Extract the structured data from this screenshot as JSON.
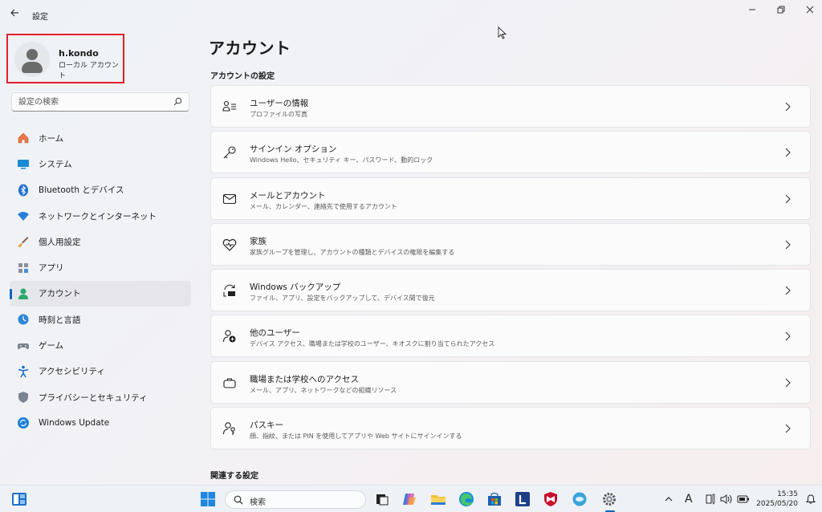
{
  "window": {
    "title": "設定",
    "back_icon": "back-arrow-icon",
    "controls": [
      "minimize",
      "maximize",
      "close"
    ]
  },
  "user": {
    "name": "h.kondo",
    "account_type": "ローカル アカウント"
  },
  "search": {
    "placeholder": "設定の検索"
  },
  "sidebar": {
    "items": [
      {
        "label": "ホーム",
        "icon": "home-icon",
        "active": false
      },
      {
        "label": "システム",
        "icon": "system-icon",
        "active": false
      },
      {
        "label": "Bluetooth とデバイス",
        "icon": "bluetooth-icon",
        "active": false
      },
      {
        "label": "ネットワークとインターネット",
        "icon": "network-icon",
        "active": false
      },
      {
        "label": "個人用設定",
        "icon": "personalization-brush-icon",
        "active": false
      },
      {
        "label": "アプリ",
        "icon": "apps-icon",
        "active": false
      },
      {
        "label": "アカウント",
        "icon": "account-icon",
        "active": true
      },
      {
        "label": "時刻と言語",
        "icon": "time-language-icon",
        "active": false
      },
      {
        "label": "ゲーム",
        "icon": "gaming-icon",
        "active": false
      },
      {
        "label": "アクセシビリティ",
        "icon": "accessibility-icon",
        "active": false
      },
      {
        "label": "プライバシーとセキュリティ",
        "icon": "shield-icon",
        "active": false
      },
      {
        "label": "Windows Update",
        "icon": "windows-update-icon",
        "active": false
      }
    ]
  },
  "main": {
    "title": "アカウント",
    "section_title": "アカウントの設定",
    "cards": [
      {
        "title": "ユーザーの情報",
        "subtitle": "プロファイルの写真",
        "icon": "user-info-icon"
      },
      {
        "title": "サインイン オプション",
        "subtitle": "Windows Hello、セキュリティ キー、パスワード、動的ロック",
        "icon": "key-icon"
      },
      {
        "title": "メールとアカウント",
        "subtitle": "メール、カレンダー、連絡先で使用するアカウント",
        "icon": "mail-icon"
      },
      {
        "title": "家族",
        "subtitle": "家族グループを管理し、アカウントの種類とデバイスの権限を編集する",
        "icon": "family-heart-icon"
      },
      {
        "title": "Windows バックアップ",
        "subtitle": "ファイル、アプリ、設定をバックアップして、デバイス間で復元",
        "icon": "backup-icon"
      },
      {
        "title": "他のユーザー",
        "subtitle": "デバイス アクセス、職場または学校のユーザー、キオスクに割り当てられたアクセス",
        "icon": "add-user-icon"
      },
      {
        "title": "職場または学校へのアクセス",
        "subtitle": "メール、アプリ、ネットワークなどの組織リソース",
        "icon": "briefcase-icon"
      },
      {
        "title": "パスキー",
        "subtitle": "顔、指紋、または PIN を使用してアプリや Web サイトにサインインする",
        "icon": "passkey-icon"
      }
    ],
    "related_title": "関連する設定"
  },
  "taskbar": {
    "search_label": "検索",
    "apps": [
      "widgets-icon",
      "start-icon",
      "task-view-icon",
      "copilot-icon",
      "file-explorer-icon",
      "edge-icon",
      "store-icon",
      "l-app-icon",
      "mcafee-icon",
      "app-circle-icon",
      "settings-gear-icon"
    ],
    "tray_icons": [
      "chevron-up-icon",
      "ime-mode-icon",
      "pen-icon",
      "volume-icon",
      "battery-icon"
    ],
    "ime_label": "A",
    "time": "15:35",
    "date": "2025/05/20",
    "accent": "#0067c0"
  }
}
